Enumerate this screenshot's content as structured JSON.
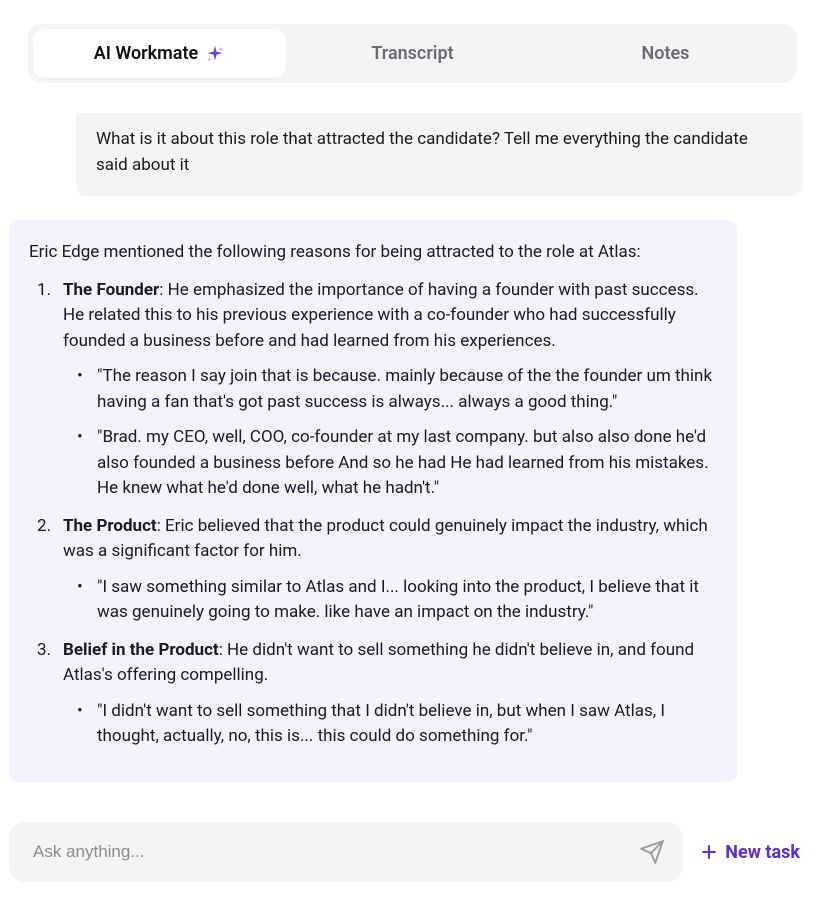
{
  "tabs": {
    "ai_workmate": "AI Workmate",
    "transcript": "Transcript",
    "notes": "Notes"
  },
  "user_message": "What is it about this role that attracted the candidate? Tell me everything the candidate said about it",
  "response": {
    "intro": "Eric Edge mentioned the following reasons for being attracted to the role at Atlas:",
    "items": [
      {
        "title": "The Founder",
        "body": ": He emphasized the importance of having a founder with past success. He related this to his previous experience with a co-founder who had successfully founded a business before and had learned from his experiences.",
        "quotes": [
          "\"The reason I say join that is because. mainly because of the the founder um think having a fan that's got past success is always... always a good thing.\"",
          "\"Brad. my CEO, well, COO, co-founder at my last company. but also also done he'd also founded a business before And so he had He had learned from his mistakes. He knew what he'd done well, what he hadn't.\""
        ]
      },
      {
        "title": "The Product",
        "body": ": Eric believed that the product could genuinely impact the industry, which was a significant factor for him.",
        "quotes": [
          "\"I saw something similar to Atlas and I... looking into the product, I believe that it was genuinely going to make. like have an impact on the industry.\""
        ]
      },
      {
        "title": "Belief in the Product",
        "body": ": He didn't want to sell something he didn't believe in, and found Atlas's offering compelling.",
        "quotes": [
          "\"I didn't want to sell something that I didn't believe in, but when I saw Atlas, I thought, actually, no, this is... this could do something for.\""
        ]
      }
    ]
  },
  "input": {
    "placeholder": "Ask anything..."
  },
  "new_task_label": "New task",
  "colors": {
    "accent": "#5b2be0",
    "sparkle": "#6c3cf0"
  }
}
